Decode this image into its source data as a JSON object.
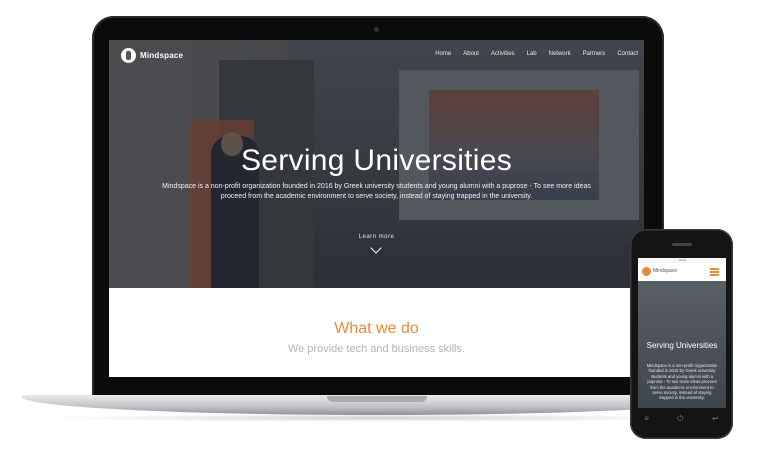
{
  "laptop": {
    "brand": "Mindspace",
    "nav": [
      "Home",
      "About",
      "Activities",
      "Lab",
      "Network",
      "Partners",
      "Contact"
    ],
    "hero": {
      "title": "Serving Universities",
      "description": "Mindspace is a non-profit organization founded in 2016 by Greek university students and young alumni with a puprose - To see more ideas proceed from the academic environment to serve society, instead of staying trapped in the university.",
      "learn_more": "Learn more"
    },
    "section": {
      "title": "What we do",
      "subtitle": "We provide tech and business skills."
    }
  },
  "phone": {
    "status": "12:00",
    "brand": "Mindspace",
    "hero": {
      "title": "Serving Universities",
      "description": "Mindspace is a non-profit organization founded in 2016 by Greek university students and young alumni with a puprose - To see more ideas proceed from the academic environment to serve society, instead of staying trapped in the university."
    },
    "buttons": [
      "≡",
      "⏻",
      "↩"
    ]
  },
  "colors": {
    "accent": "#e88a3a",
    "subtitle": "#b5b5b5"
  }
}
